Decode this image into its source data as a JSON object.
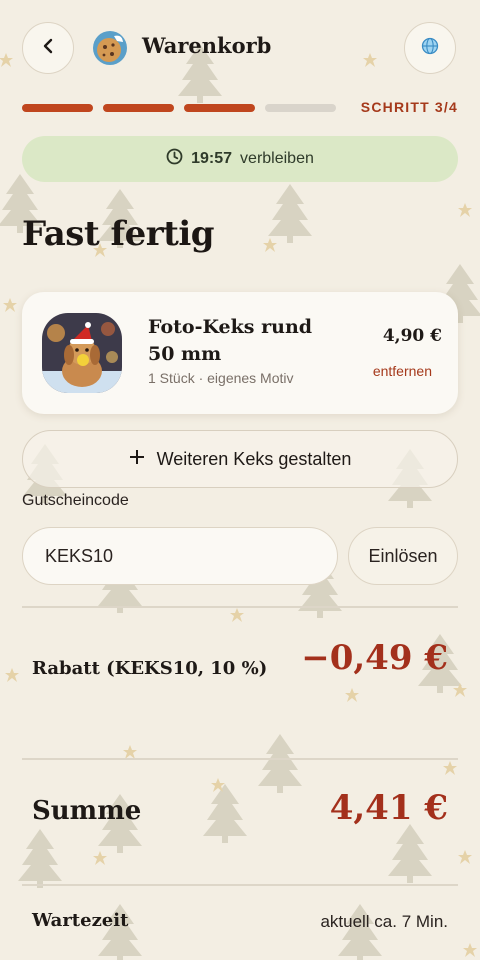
{
  "header": {
    "title": "Warenkorb",
    "back_icon": "chevron-left-icon",
    "lang_icon": "globe-icon"
  },
  "progress": {
    "current_step": 3,
    "total_steps": 4,
    "label": "SCHRITT 3/4"
  },
  "timer": {
    "time": "19:57",
    "suffix": "verbleiben",
    "icon": "clock-icon"
  },
  "page": {
    "heading": "Fast fertig"
  },
  "cart": {
    "items": [
      {
        "name": "Foto-Keks rund 50 mm",
        "meta": "1 Stück · eigenes Motiv",
        "price": "4,90 €",
        "remove_label": "entfernen"
      }
    ]
  },
  "add_button": {
    "label": "Weiteren Keks gestalten",
    "icon": "plus-icon"
  },
  "coupon": {
    "label": "Gutscheincode",
    "value": "KEKS10",
    "redeem_label": "Einlösen"
  },
  "summary": {
    "discount_label": "Rabatt (KEKS10, 10 %)",
    "discount_value": "−0,49 €",
    "sum_label": "Summe",
    "sum_value": "4,41 €",
    "wait_label": "Wartezeit",
    "wait_value": "aktuell ca. 7 Min."
  },
  "colors": {
    "accent": "#c0461e",
    "price_red": "#a3301c",
    "timer_bg": "#dbe8c6",
    "background": "#f3eee3"
  }
}
